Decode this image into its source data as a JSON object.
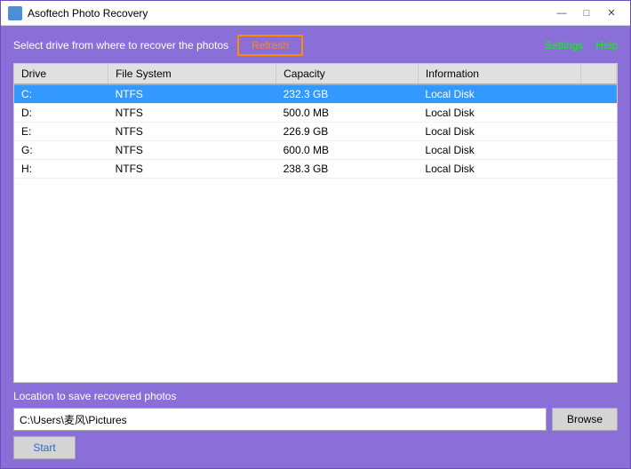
{
  "window": {
    "title": "Asoftech Photo Recovery",
    "icon_color": "#4a90d9"
  },
  "titlebar_buttons": {
    "minimize": "—",
    "maximize": "□",
    "close": "✕"
  },
  "toolbar": {
    "select_label": "Select drive from where to recover the photos",
    "refresh_label": "Refresh",
    "settings_label": "Settings",
    "help_label": "Help"
  },
  "table": {
    "columns": [
      "Drive",
      "File System",
      "Capacity",
      "Information"
    ],
    "rows": [
      {
        "drive": "C:",
        "filesystem": "NTFS",
        "capacity": "232.3 GB",
        "info": "Local Disk",
        "selected": true
      },
      {
        "drive": "D:",
        "filesystem": "NTFS",
        "capacity": "500.0 MB",
        "info": "Local Disk",
        "selected": false
      },
      {
        "drive": "E:",
        "filesystem": "NTFS",
        "capacity": "226.9 GB",
        "info": "Local Disk",
        "selected": false
      },
      {
        "drive": "G:",
        "filesystem": "NTFS",
        "capacity": "600.0 MB",
        "info": "Local Disk",
        "selected": false
      },
      {
        "drive": "H:",
        "filesystem": "NTFS",
        "capacity": "238.3 GB",
        "info": "Local Disk",
        "selected": false
      }
    ]
  },
  "bottom": {
    "save_label": "Location to save recovered photos",
    "save_path": "C:\\Users\\麦风\\Pictures",
    "browse_label": "Browse",
    "start_label": "Start"
  }
}
